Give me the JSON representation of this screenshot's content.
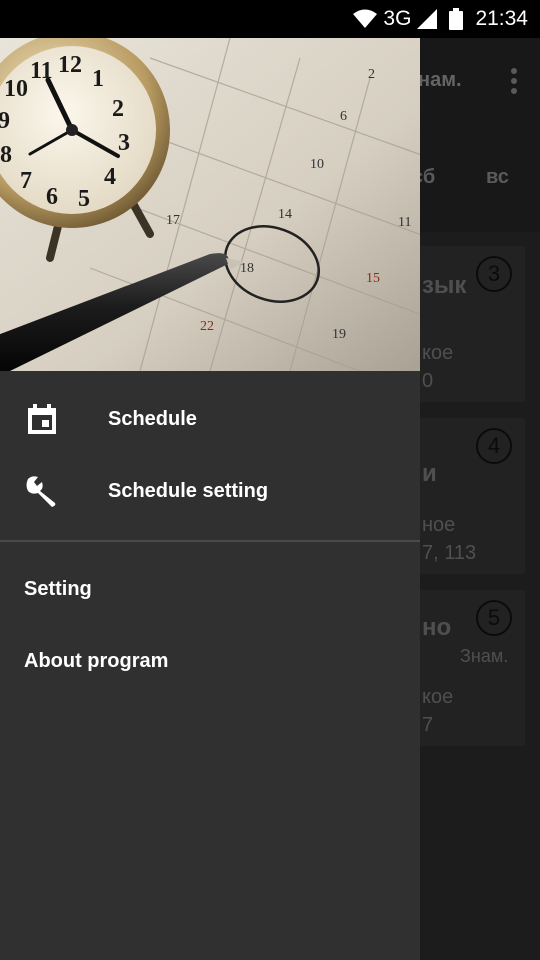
{
  "status_bar": {
    "network": "3G",
    "time": "21:34"
  },
  "background": {
    "toolbar_title": "нам.",
    "tabs": [
      "сб",
      "вс"
    ],
    "cards": [
      {
        "number": "3",
        "line1": "зык",
        "line2": "кое",
        "line3": "0"
      },
      {
        "number": "4",
        "line1": "и",
        "line2": "ное",
        "line3": "7, 113"
      },
      {
        "number": "5",
        "line1": "но",
        "line_tag": "Знам.",
        "line2": "кое",
        "line3": "7"
      }
    ]
  },
  "drawer": {
    "nav_items": [
      {
        "label": "Schedule",
        "icon": "calendar-icon"
      },
      {
        "label": "Schedule setting",
        "icon": "wrench-icon"
      }
    ],
    "menu_items": [
      {
        "label": "Setting"
      },
      {
        "label": "About program"
      }
    ]
  },
  "colors": {
    "drawer_bg": "#303030",
    "status_bar_bg": "#000000",
    "text": "#ffffff"
  }
}
